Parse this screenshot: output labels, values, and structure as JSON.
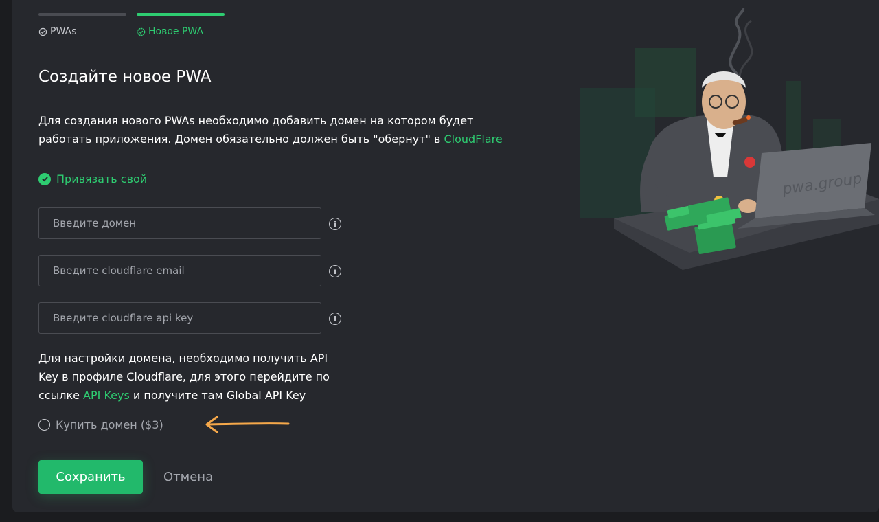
{
  "tabs": [
    {
      "label": "PWAs",
      "icon": "check-circle-outline-icon",
      "active": false
    },
    {
      "label": "Новое PWA",
      "icon": "settings-check-icon",
      "active": true
    }
  ],
  "page": {
    "title": "Создайте новое PWA",
    "description_text": "Для создания нового PWAs необходимо добавить домен на котором будет работать приложения. Домен обязательно должен быть \"обернут\" в ",
    "description_link": "CloudFlare"
  },
  "options": {
    "bind_own_label": "Привязать свой",
    "buy_domain_label": "Купить домен ($3)"
  },
  "fields": {
    "domain_placeholder": "Введите домен",
    "email_placeholder": "Введите cloudflare email",
    "api_key_placeholder": "Введите cloudflare api key"
  },
  "help": {
    "text_before": "Для настройки домена, необходимо получить API Key в профиле Cloudflare, для этого перейдите по ссылке ",
    "link": "API Keys",
    "text_after": " и получите там Global API Key"
  },
  "actions": {
    "save_label": "Сохранить",
    "cancel_label": "Отмена"
  },
  "illustration": {
    "laptop_text": "pwa.group"
  },
  "colors": {
    "accent": "#2ecc71",
    "background": "#26282d",
    "arrow": "#f5a84a"
  }
}
